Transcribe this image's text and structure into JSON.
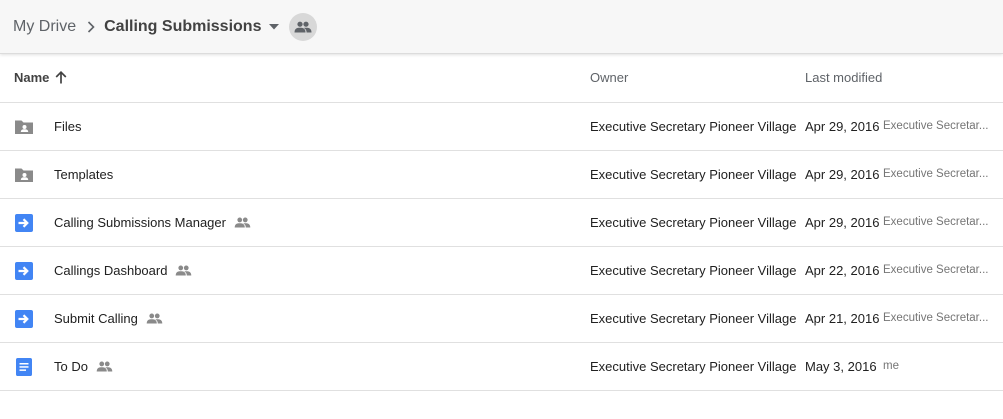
{
  "breadcrumb": {
    "root_label": "My Drive",
    "current_label": "Calling Submissions"
  },
  "columns": {
    "name": "Name",
    "owner": "Owner",
    "last_modified": "Last modified"
  },
  "files": [
    {
      "icon": "shared-folder-icon",
      "name": "Files",
      "shared": false,
      "owner": "Executive Secretary Pioneer Village",
      "modified": "Apr 29, 2016",
      "modified_by": "Executive Secretar..."
    },
    {
      "icon": "shared-folder-icon",
      "name": "Templates",
      "shared": false,
      "owner": "Executive Secretary Pioneer Village",
      "modified": "Apr 29, 2016",
      "modified_by": "Executive Secretar..."
    },
    {
      "icon": "google-form-icon",
      "name": "Calling Submissions Manager",
      "shared": true,
      "owner": "Executive Secretary Pioneer Village",
      "modified": "Apr 29, 2016",
      "modified_by": "Executive Secretar..."
    },
    {
      "icon": "google-form-icon",
      "name": "Callings Dashboard",
      "shared": true,
      "owner": "Executive Secretary Pioneer Village",
      "modified": "Apr 22, 2016",
      "modified_by": "Executive Secretar..."
    },
    {
      "icon": "google-form-icon",
      "name": "Submit Calling",
      "shared": true,
      "owner": "Executive Secretary Pioneer Village",
      "modified": "Apr 21, 2016",
      "modified_by": "Executive Secretar..."
    },
    {
      "icon": "google-doc-icon",
      "name": "To Do",
      "shared": true,
      "owner": "Executive Secretary Pioneer Village",
      "modified": "May 3, 2016",
      "modified_by": "me"
    }
  ],
  "colors": {
    "folder_gray": "#8a8a8a",
    "form_blue": "#4285f4",
    "doc_blue": "#4285f4",
    "shared_gray": "#8a8a8a"
  }
}
